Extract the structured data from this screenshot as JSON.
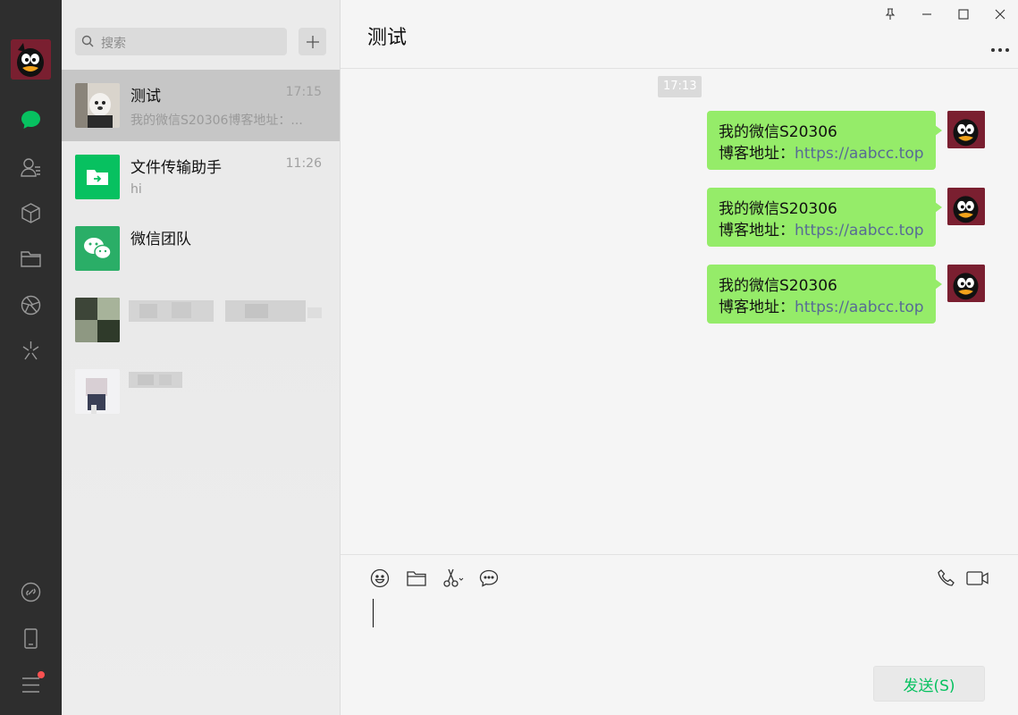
{
  "search": {
    "placeholder": "搜索"
  },
  "conversations": [
    {
      "name": "测试",
      "time": "17:15",
      "preview": "我的微信S20306博客地址：..."
    },
    {
      "name": "文件传输助手",
      "time": "11:26",
      "preview": "hi"
    },
    {
      "name": "微信团队",
      "time": "",
      "preview": ""
    }
  ],
  "chat": {
    "title": "测试",
    "timestamp": "17:13",
    "messages": [
      {
        "line1": "我的微信S20306",
        "label": "博客地址：",
        "link": "https://aabcc.top"
      },
      {
        "line1": "我的微信S20306",
        "label": "博客地址：",
        "link": "https://aabcc.top"
      },
      {
        "line1": "我的微信S20306",
        "label": "博客地址：",
        "link": "https://aabcc.top"
      }
    ],
    "send_label": "发送(S)"
  },
  "colors": {
    "accent": "#07c160",
    "bubble": "#95ec69",
    "sidebar": "#2e2e2e",
    "link": "#576b95",
    "badge": "#fa5151"
  },
  "icons": {
    "nav": [
      "chat-icon",
      "contacts-icon",
      "favorites-icon",
      "files-icon",
      "moments-icon",
      "mini-programs-icon",
      "phone-sync-icon",
      "mobile-icon",
      "menu-icon"
    ],
    "window": [
      "pin-icon",
      "minimize-icon",
      "maximize-icon",
      "close-icon"
    ],
    "toolbar": [
      "emoji-icon",
      "folder-icon",
      "screenshot-icon",
      "chat-history-icon",
      "voice-call-icon",
      "video-call-icon"
    ]
  }
}
